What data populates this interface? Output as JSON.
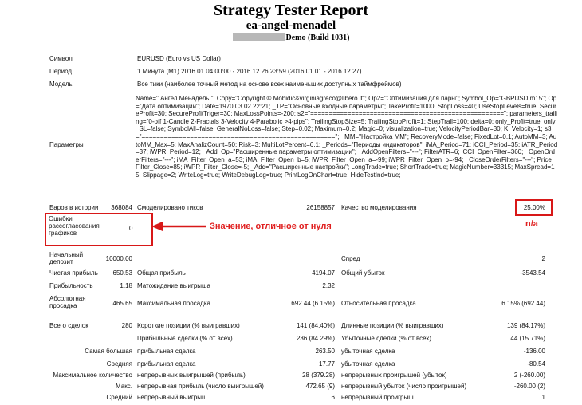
{
  "header": {
    "title": "Strategy Tester Report",
    "ea_name": "ea-angel-menadel",
    "build": "Demo (Build 1031)"
  },
  "info": {
    "symbol_label": "Символ",
    "symbol_value": "EURUSD (Euro vs US Dollar)",
    "period_label": "Период",
    "period_value": "1 Минута (M1) 2016.01.04 00:00 - 2016.12.26 23:59 (2016.01.01 - 2016.12.27)",
    "model_label": "Модель",
    "model_value": "Все тики (наиболее точный метод на основе всех наименьших доступных таймфреймов)",
    "params_label": "Параметры",
    "params_value": "Name=\" Ангел Менадель \"; Copy=\"Copyright © Mobidic&virginiagreco@libero.it\"; Op2=\"Оптимизация для пары\"; Symbol_Op=\"GBPUSD m15\"; Op=\"Дата оптимизации\"; Date=1970.03.02 22:21; _TP=\"Основные входные параметры\"; TakeProfit=1000; StopLoss=40; UseStopLevels=true; SecureProfit=30; SecureProfitTriger=30; MaxLossPoints=-200; s2=\"====================================================\"; parameters_trailing=\"0-off 1-Candle 2-Fractals 3-Velocity 4-Parabolic >4-pips\"; TrailingStopSize=5; TrailingStopProfit=1; StepTrall=100; delta=0; only_Profit=true; only_SL=false; SymbolAll=false; GeneralNoLoss=false; Step=0.02; Maximum=0.2; Magic=0; visualization=true; VelocityPeriodBar=30; K_Velocity=1; s3=\"====================================================\"; _MM=\"Настройка ММ\"; RecoveryMode=false; FixedLot=0.1; AutoMM=3; AutoMM_Max=5; MaxAnalizCount=50; Risk=3; MultiLotPercent=6.1; _Periods=\"Периоды индикаторов\"; iMA_Period=71; iCCI_Period=35; iATR_Period=37; iWPR_Period=12; _Add_Op=\"Расширенные параметры оптимизации\"; _AddOpenFilters=\"---\"; FilterATR=6; iCCI_OpenFilter=360; _OpenOrderFilters=\"---\"; iMA_Filter_Open_a=53; iMA_Filter_Open_b=5; iWPR_Filter_Open_a=-99; iWPR_Filter_Open_b=-94; _CloseOrderFilters=\"---\"; Price_Filter_Close=85; iWPR_Filter_Close=-5; _Add=\"Расширенные настройки\"; LongTrade=true; ShortTrade=true; MagicNumber=33315; MaxSpread=15; Slippage=2; WriteLog=true; WriteDebugLog=true; PrintLogOnChart=true; HideTestInd=true;"
  },
  "bars": {
    "label": "Баров в истории",
    "value": "368084",
    "ticks_label": "Смоделировано тиков",
    "ticks_value": "26158857",
    "quality_label": "Качество моделирования",
    "quality_value": "25.00%"
  },
  "errors": {
    "label": "Ошибки рассогласования графиков",
    "value": "0"
  },
  "annotations": {
    "arrow_note": "Значение, отличное от нуля",
    "na_note": "n/a"
  },
  "stats": {
    "deposit_label": "Начальный депозит",
    "deposit_value": "10000.00",
    "spread_label": "Спред",
    "spread_value": "2",
    "net_profit_label": "Чистая прибыль",
    "net_profit_value": "650.53",
    "gross_profit_label": "Общая прибыль",
    "gross_profit_value": "4194.07",
    "gross_loss_label": "Общий убыток",
    "gross_loss_value": "-3543.54",
    "pf_label": "Прибыльность",
    "pf_value": "1.18",
    "payoff_label": "Матожидание выигрыша",
    "payoff_value": "2.32",
    "abs_dd_label": "Абсолютная просадка",
    "abs_dd_value": "465.65",
    "max_dd_label": "Максимальная просадка",
    "max_dd_value": "692.44 (6.15%)",
    "rel_dd_label": "Относительная просадка",
    "rel_dd_value": "6.15% (692.44)",
    "total_trades_label": "Всего сделок",
    "total_trades_value": "280",
    "short_label": "Короткие позиции (% выигравших)",
    "short_value": "141 (84.40%)",
    "long_label": "Длинные позиции (% выигравших)",
    "long_value": "139 (84.17%)",
    "profit_trades_label": "Прибыльные сделки (% от всех)",
    "profit_trades_value": "236 (84.29%)",
    "loss_trades_label": "Убыточные сделки (% от всех)",
    "loss_trades_value": "44 (15.71%)",
    "largest_label": "Самая большая",
    "largest_profit_label": "прибыльная сделка",
    "largest_profit_value": "263.50",
    "largest_loss_label": "убыточная сделка",
    "largest_loss_value": "-136.00",
    "average_label": "Средняя",
    "average_profit_label": "прибыльная сделка",
    "average_profit_value": "17.77",
    "average_loss_label": "убыточная сделка",
    "average_loss_value": "-80.54",
    "max_count_label": "Максимальное количество",
    "max_cons_wins_label": "непрерывных выигрышей (прибыль)",
    "max_cons_wins_value": "28 (379.28)",
    "max_cons_losses_label": "непрерывных проигрышей (убыток)",
    "max_cons_losses_value": "2 (-260.00)",
    "max_label": "Макс.",
    "max_cons_profit_label": "непрерывная прибыль (число выигрышей)",
    "max_cons_profit_value": "472.65 (9)",
    "max_cons_loss_label": "непрерывный убыток (число проигрышей)",
    "max_cons_loss_value": "-260.00 (2)",
    "avg2_label": "Средний",
    "avg_cons_win_label": "непрерывный выигрыш",
    "avg_cons_win_value": "6",
    "avg_cons_loss_label": "непрерывный проигрыш",
    "avg_cons_loss_value": "1"
  },
  "colors": {
    "accent_red": "#d81818"
  }
}
